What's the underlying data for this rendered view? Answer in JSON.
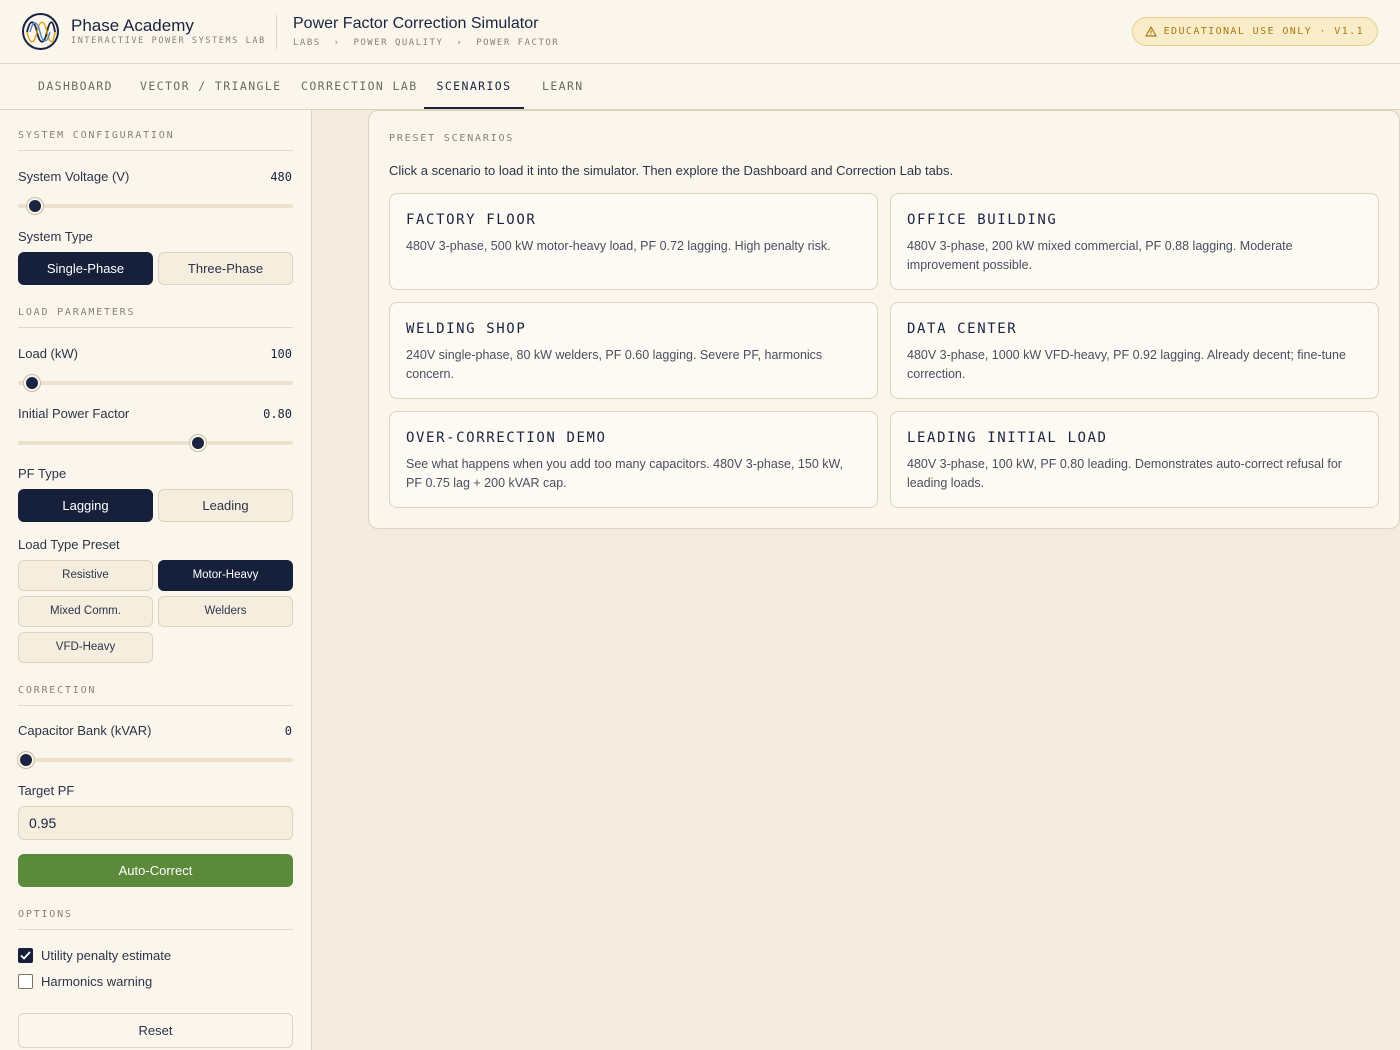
{
  "brand": {
    "name": "Phase Academy",
    "subtitle": "INTERACTIVE POWER SYSTEMS LAB"
  },
  "header": {
    "title": "Power Factor Correction Simulator",
    "breadcrumb": [
      "LABS",
      "POWER QUALITY",
      "POWER FACTOR"
    ],
    "breadcrumb_sep": "›",
    "badge": "EDUCATIONAL USE ONLY · V1.1"
  },
  "tabs": [
    {
      "label": "DASHBOARD",
      "active": false
    },
    {
      "label": "VECTOR / TRIANGLE",
      "active": false
    },
    {
      "label": "CORRECTION LAB",
      "active": false
    },
    {
      "label": "SCENARIOS",
      "active": true
    },
    {
      "label": "LEARN",
      "active": false
    }
  ],
  "sidebar": {
    "system_config": {
      "title": "SYSTEM CONFIGURATION",
      "voltage_label": "System Voltage (V)",
      "voltage_value": "480",
      "voltage_fraction": 0.06,
      "system_type_label": "System Type",
      "single_phase": "Single-Phase",
      "three_phase": "Three-Phase",
      "selected_system_type": "Single-Phase"
    },
    "load": {
      "title": "LOAD PARAMETERS",
      "load_label": "Load (kW)",
      "load_value": "100",
      "load_fraction": 0.05,
      "pf_label": "Initial Power Factor",
      "pf_value": "0.80",
      "pf_fraction": 0.655,
      "pf_type_label": "PF Type",
      "lagging": "Lagging",
      "leading": "Leading",
      "selected_pf_type": "Lagging",
      "preset_label": "Load Type Preset",
      "presets": [
        "Resistive",
        "Motor-Heavy",
        "Mixed Comm.",
        "Welders",
        "VFD-Heavy"
      ],
      "selected_preset": "Motor-Heavy"
    },
    "correction": {
      "title": "CORRECTION",
      "cap_label": "Capacitor Bank (kVAR)",
      "cap_value": "0",
      "cap_fraction": 0.03,
      "target_label": "Target PF",
      "target_value": "0.95",
      "auto_correct": "Auto-Correct"
    },
    "options": {
      "title": "OPTIONS",
      "penalty_label": "Utility penalty estimate",
      "penalty_checked": true,
      "harmonics_label": "Harmonics warning",
      "harmonics_checked": false
    },
    "reset": "Reset"
  },
  "scenarios": {
    "title": "PRESET SCENARIOS",
    "description": "Click a scenario to load it into the simulator. Then explore the Dashboard and Correction Lab tabs.",
    "cards": [
      {
        "title": "FACTORY FLOOR",
        "desc": "480V 3-phase, 500 kW motor-heavy load, PF 0.72 lagging. High penalty risk."
      },
      {
        "title": "OFFICE BUILDING",
        "desc": "480V 3-phase, 200 kW mixed commercial, PF 0.88 lagging. Moderate improvement possible."
      },
      {
        "title": "WELDING SHOP",
        "desc": "240V single-phase, 80 kW welders, PF 0.60 lagging. Severe PF, harmonics concern."
      },
      {
        "title": "DATA CENTER",
        "desc": "480V 3-phase, 1000 kW VFD-heavy, PF 0.92 lagging. Already decent; fine-tune correction."
      },
      {
        "title": "OVER-CORRECTION DEMO",
        "desc": "See what happens when you add too many capacitors. 480V 3-phase, 150 kW, PF 0.75 lag + 200 kVAR cap."
      },
      {
        "title": "LEADING INITIAL LOAD",
        "desc": "480V 3-phase, 100 kW, PF 0.80 leading. Demonstrates auto-correct refusal for leading loads."
      }
    ]
  },
  "colors": {
    "navy": "#17203b",
    "green": "#5a8a3a",
    "cream": "#faf6ec",
    "amber": "#a67a14"
  },
  "icons": {
    "logo": "sine-wave-logo-icon",
    "badge": "warning-triangle-icon",
    "check": "checkmark-icon"
  }
}
